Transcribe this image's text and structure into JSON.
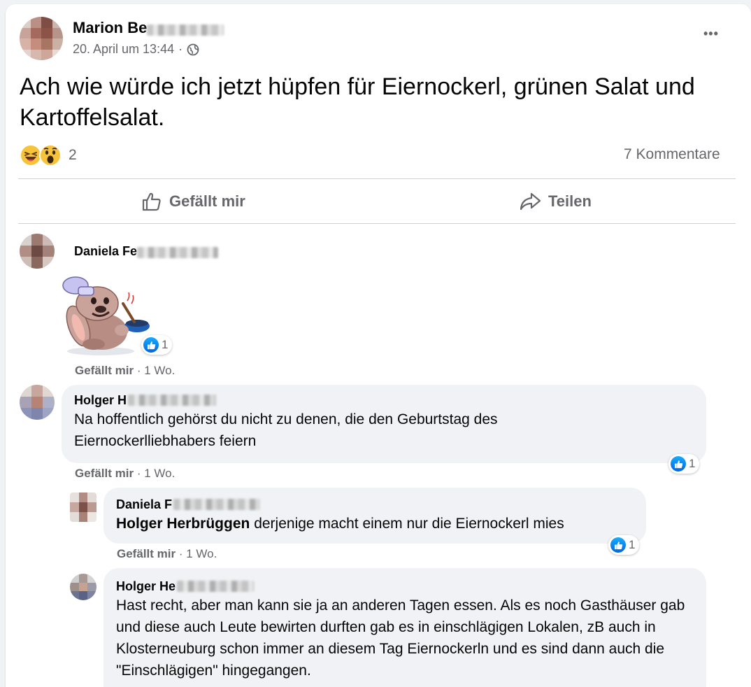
{
  "post": {
    "author_first": "Marion Be",
    "timestamp": "20. April um 13:44",
    "visibility_sep": "·",
    "text": "Ach wie würde ich jetzt hüpfen für Eiernockerl, grünen Salat und Kartoffelsalat.",
    "reaction_count": "2",
    "comment_count": "7 Kommentare",
    "more_icon": "•••"
  },
  "actions": {
    "like_label": "Gefällt mir",
    "share_label": "Teilen"
  },
  "comments": [
    {
      "author": "Daniela Fe",
      "type": "sticker",
      "sticker": "chef-bunny-sticker",
      "reaction_count": "1",
      "like_label": "Gefällt mir",
      "sep": "·",
      "time": "1 Wo."
    },
    {
      "author": "Holger H",
      "text": "Na hoffentlich gehörst du nicht zu denen, die den Geburtstag des Eiernockerlliebhabers feiern",
      "reaction_count": "1",
      "like_label": "Gefällt mir",
      "sep": "·",
      "time": "1 Wo."
    },
    {
      "author": "Daniela F",
      "mention": "Holger Herbrüggen",
      "text": " derjenige macht einem nur die Eiernockerl mies",
      "reaction_count": "1",
      "like_label": "Gefällt mir",
      "sep": "·",
      "time": "1 Wo."
    },
    {
      "author": "Holger He",
      "text": "Hast recht, aber man kann sie ja an anderen Tagen essen. Als es noch Gasthäuser gab und diese auch Leute bewirten durften gab es in einschlägigen Lokalen, zB auch in Klosterneuburg schon immer an diesem Tag Eiernockerln und es sind dann auch die \"Einschlägigen\" hingegangen."
    }
  ],
  "colors": {
    "like_blue": "#1877f2",
    "secondary_text": "#65676b",
    "bubble_bg": "#f0f2f5"
  }
}
